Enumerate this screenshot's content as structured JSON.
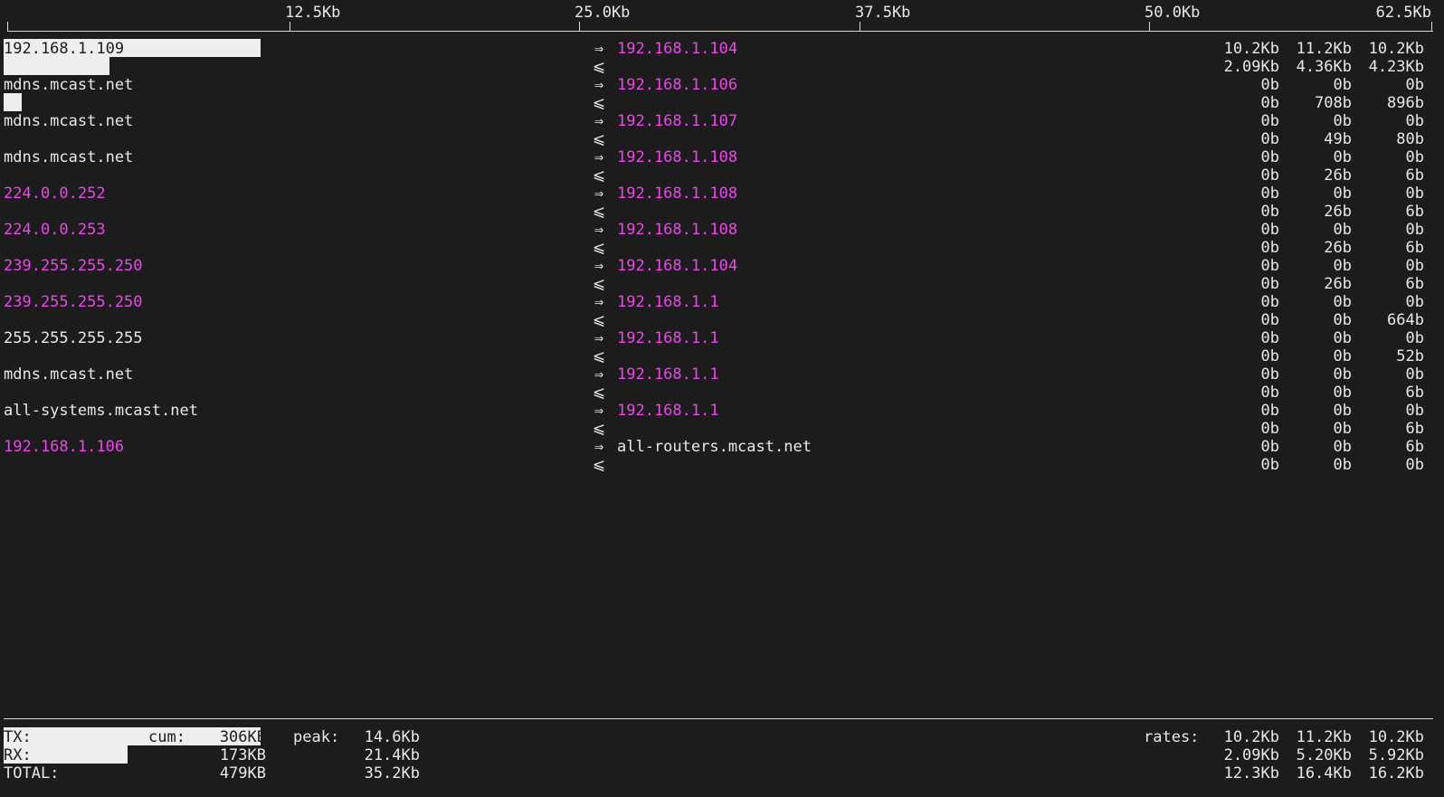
{
  "scale": {
    "ticks": [
      "12.5Kb",
      "25.0Kb",
      "37.5Kb",
      "50.0Kb",
      "62.5Kb"
    ]
  },
  "colors": {
    "background": "#1c1c1c",
    "text": "#e8e8e8",
    "host_highlight": "#ef44ef",
    "bar": "#eeeeee"
  },
  "arrows": {
    "sent": "⇒",
    "recv": "⩽"
  },
  "connections": [
    {
      "src": "192.168.1.109",
      "src_color": "text",
      "dst": "192.168.1.104",
      "dst_color": "magenta",
      "tx": [
        "10.2Kb",
        "11.2Kb",
        "10.2Kb"
      ],
      "rx": [
        "2.09Kb",
        "4.36Kb",
        "4.23Kb"
      ],
      "tx_bar_fraction": 0.18,
      "rx_bar_fraction": 0.074
    },
    {
      "src": "mdns.mcast.net",
      "src_color": "text",
      "dst": "192.168.1.106",
      "dst_color": "magenta",
      "tx": [
        "0b",
        "0b",
        "0b"
      ],
      "rx": [
        "0b",
        "708b",
        "896b"
      ],
      "tx_bar_fraction": 0,
      "rx_bar_fraction": 0.012
    },
    {
      "src": "mdns.mcast.net",
      "src_color": "text",
      "dst": "192.168.1.107",
      "dst_color": "magenta",
      "tx": [
        "0b",
        "0b",
        "0b"
      ],
      "rx": [
        "0b",
        "49b",
        "80b"
      ],
      "tx_bar_fraction": 0,
      "rx_bar_fraction": 0
    },
    {
      "src": "mdns.mcast.net",
      "src_color": "text",
      "dst": "192.168.1.108",
      "dst_color": "magenta",
      "tx": [
        "0b",
        "0b",
        "0b"
      ],
      "rx": [
        "0b",
        "26b",
        "6b"
      ],
      "tx_bar_fraction": 0,
      "rx_bar_fraction": 0
    },
    {
      "src": "224.0.0.252",
      "src_color": "magenta",
      "dst": "192.168.1.108",
      "dst_color": "magenta",
      "tx": [
        "0b",
        "0b",
        "0b"
      ],
      "rx": [
        "0b",
        "26b",
        "6b"
      ],
      "tx_bar_fraction": 0,
      "rx_bar_fraction": 0
    },
    {
      "src": "224.0.0.253",
      "src_color": "magenta",
      "dst": "192.168.1.108",
      "dst_color": "magenta",
      "tx": [
        "0b",
        "0b",
        "0b"
      ],
      "rx": [
        "0b",
        "26b",
        "6b"
      ],
      "tx_bar_fraction": 0,
      "rx_bar_fraction": 0
    },
    {
      "src": "239.255.255.250",
      "src_color": "magenta",
      "dst": "192.168.1.104",
      "dst_color": "magenta",
      "tx": [
        "0b",
        "0b",
        "0b"
      ],
      "rx": [
        "0b",
        "26b",
        "6b"
      ],
      "tx_bar_fraction": 0,
      "rx_bar_fraction": 0
    },
    {
      "src": "239.255.255.250",
      "src_color": "magenta",
      "dst": "192.168.1.1",
      "dst_color": "magenta",
      "tx": [
        "0b",
        "0b",
        "0b"
      ],
      "rx": [
        "0b",
        "0b",
        "664b"
      ],
      "tx_bar_fraction": 0,
      "rx_bar_fraction": 0
    },
    {
      "src": "255.255.255.255",
      "src_color": "text",
      "dst": "192.168.1.1",
      "dst_color": "magenta",
      "tx": [
        "0b",
        "0b",
        "0b"
      ],
      "rx": [
        "0b",
        "0b",
        "52b"
      ],
      "tx_bar_fraction": 0,
      "rx_bar_fraction": 0
    },
    {
      "src": "mdns.mcast.net",
      "src_color": "text",
      "dst": "192.168.1.1",
      "dst_color": "magenta",
      "tx": [
        "0b",
        "0b",
        "0b"
      ],
      "rx": [
        "0b",
        "0b",
        "6b"
      ],
      "tx_bar_fraction": 0,
      "rx_bar_fraction": 0
    },
    {
      "src": "all-systems.mcast.net",
      "src_color": "text",
      "dst": "192.168.1.1",
      "dst_color": "magenta",
      "tx": [
        "0b",
        "0b",
        "0b"
      ],
      "rx": [
        "0b",
        "0b",
        "6b"
      ],
      "tx_bar_fraction": 0,
      "rx_bar_fraction": 0
    },
    {
      "src": "192.168.1.106",
      "src_color": "magenta",
      "dst": "all-routers.mcast.net",
      "dst_color": "text",
      "tx": [
        "0b",
        "0b",
        "6b"
      ],
      "rx": [
        "0b",
        "0b",
        "0b"
      ],
      "tx_bar_fraction": 0,
      "rx_bar_fraction": 0
    }
  ],
  "totals": {
    "tx_label": "TX:",
    "rx_label": "RX:",
    "total_label": "TOTAL:",
    "cum_label": "cum:",
    "peak_label": "peak:",
    "rates_label": "rates:",
    "tx_cum": "306KB",
    "rx_cum": "173KB",
    "total_cum": "479KB",
    "tx_peak": "14.6Kb",
    "rx_peak": "21.4Kb",
    "total_peak": "35.2Kb",
    "tx_rates": [
      "10.2Kb",
      "11.2Kb",
      "10.2Kb"
    ],
    "rx_rates": [
      "2.09Kb",
      "5.20Kb",
      "5.92Kb"
    ],
    "total_rates": [
      "12.3Kb",
      "16.4Kb",
      "16.2Kb"
    ],
    "tx_bar_fraction": 0.18,
    "rx_bar_fraction": 0.087
  }
}
